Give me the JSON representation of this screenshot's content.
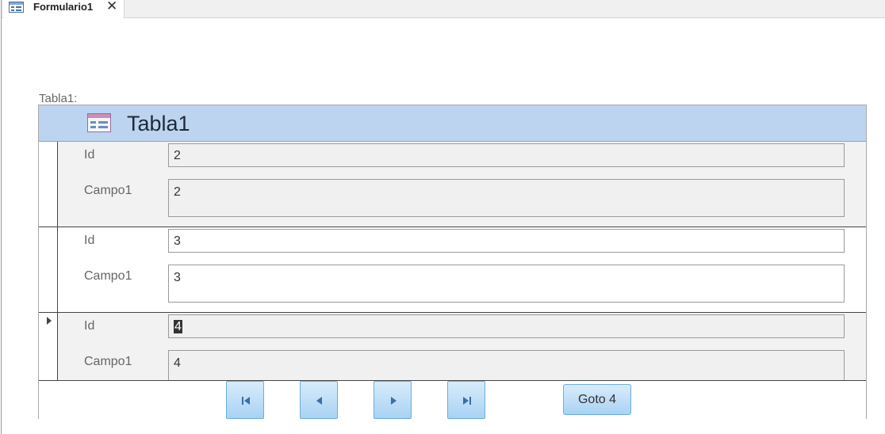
{
  "tab": {
    "label": "Formulario1",
    "close_glyph": "✕"
  },
  "form": {
    "subform_label": "Tabla1:"
  },
  "subform": {
    "title": "Tabla1",
    "header_color": "#bcd4ef",
    "records": [
      {
        "id_label": "Id",
        "id_value": "2",
        "campo_label": "Campo1",
        "campo_value": "2"
      },
      {
        "id_label": "Id",
        "id_value": "3",
        "campo_label": "Campo1",
        "campo_value": "3"
      },
      {
        "id_label": "Id",
        "id_value": "4",
        "campo_label": "Campo1",
        "campo_value": "4"
      }
    ]
  },
  "navigation": {
    "buttons": [
      "first-record-icon",
      "previous-record-icon",
      "next-record-icon",
      "last-record-icon"
    ],
    "goto_label": "Goto 4",
    "button_color": "#a9d2f3"
  }
}
